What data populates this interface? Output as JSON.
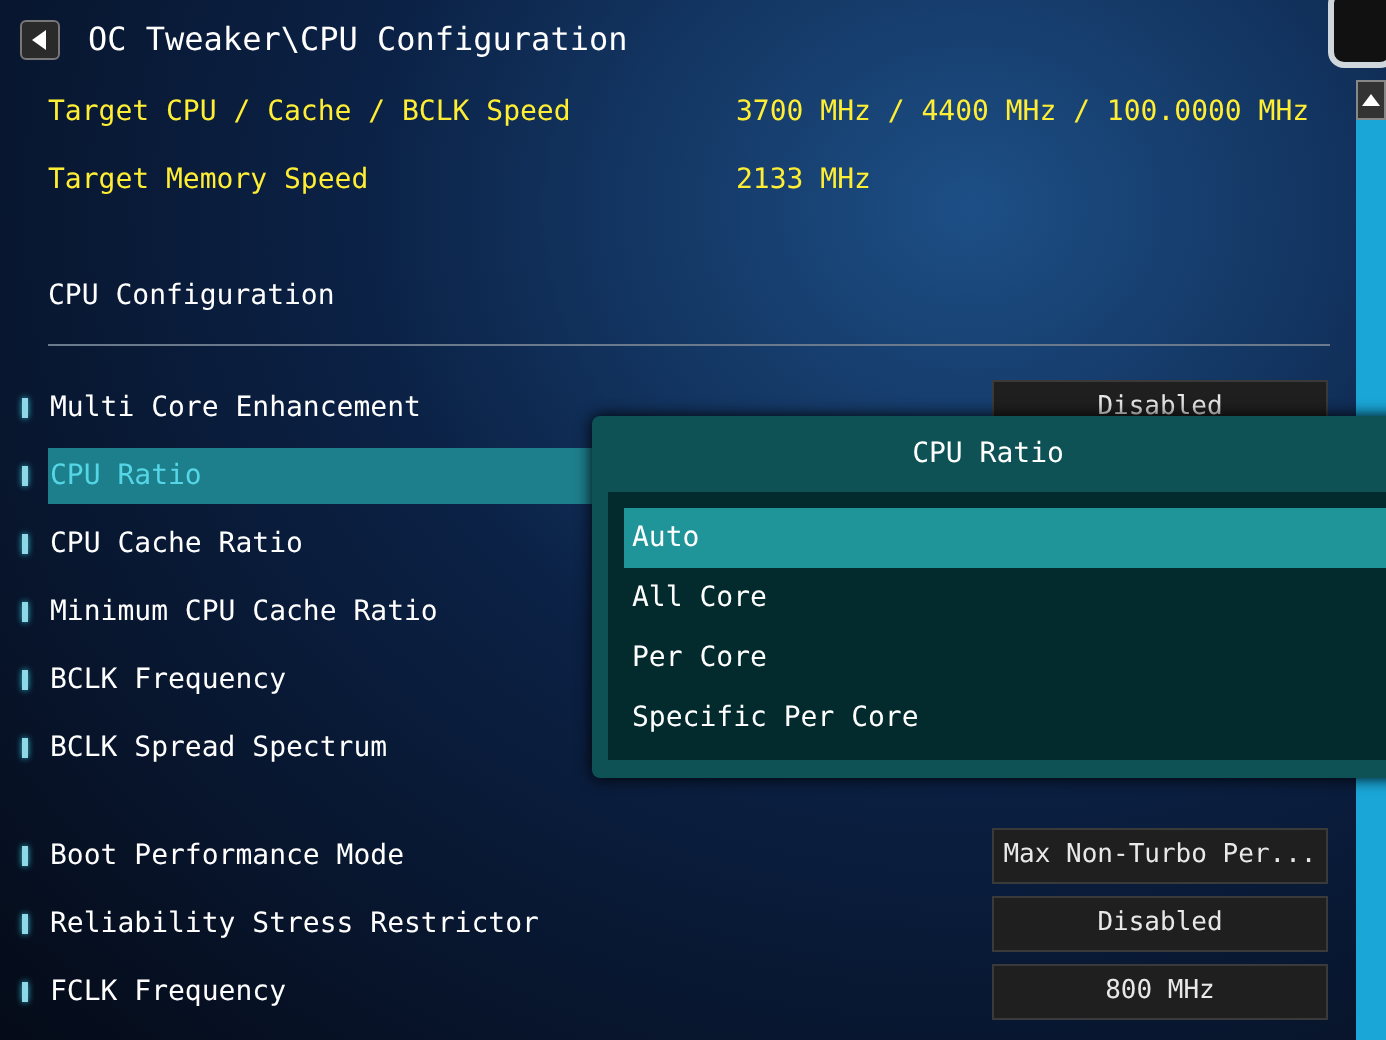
{
  "title": "OC Tweaker\\CPU Configuration",
  "info": [
    {
      "label": "Target CPU / Cache / BCLK Speed",
      "value": "3700 MHz / 4400 MHz / 100.0000 MHz"
    },
    {
      "label": "Target Memory Speed",
      "value": "2133 MHz"
    }
  ],
  "section_title": "CPU Configuration",
  "setting_groups": [
    {
      "items": [
        {
          "label": "Multi Core Enhancement",
          "value": "Disabled",
          "selected": false
        },
        {
          "label": "CPU Ratio",
          "selected": true
        },
        {
          "label": "CPU Cache Ratio",
          "selected": false
        },
        {
          "label": "Minimum CPU Cache Ratio",
          "selected": false
        },
        {
          "label": "BCLK Frequency",
          "selected": false
        },
        {
          "label": "BCLK Spread Spectrum",
          "selected": false
        }
      ]
    },
    {
      "items": [
        {
          "label": "Boot Performance Mode",
          "value": "Max Non-Turbo Per...",
          "selected": false
        },
        {
          "label": "Reliability Stress Restrictor",
          "value": "Disabled",
          "selected": false
        },
        {
          "label": "FCLK Frequency",
          "value": "800 MHz",
          "selected": false
        }
      ]
    }
  ],
  "popup": {
    "title": "CPU Ratio",
    "options": [
      {
        "label": "Auto",
        "selected": true
      },
      {
        "label": "All Core",
        "selected": false
      },
      {
        "label": "Per Core",
        "selected": false
      },
      {
        "label": "Specific Per Core",
        "selected": false
      }
    ]
  }
}
